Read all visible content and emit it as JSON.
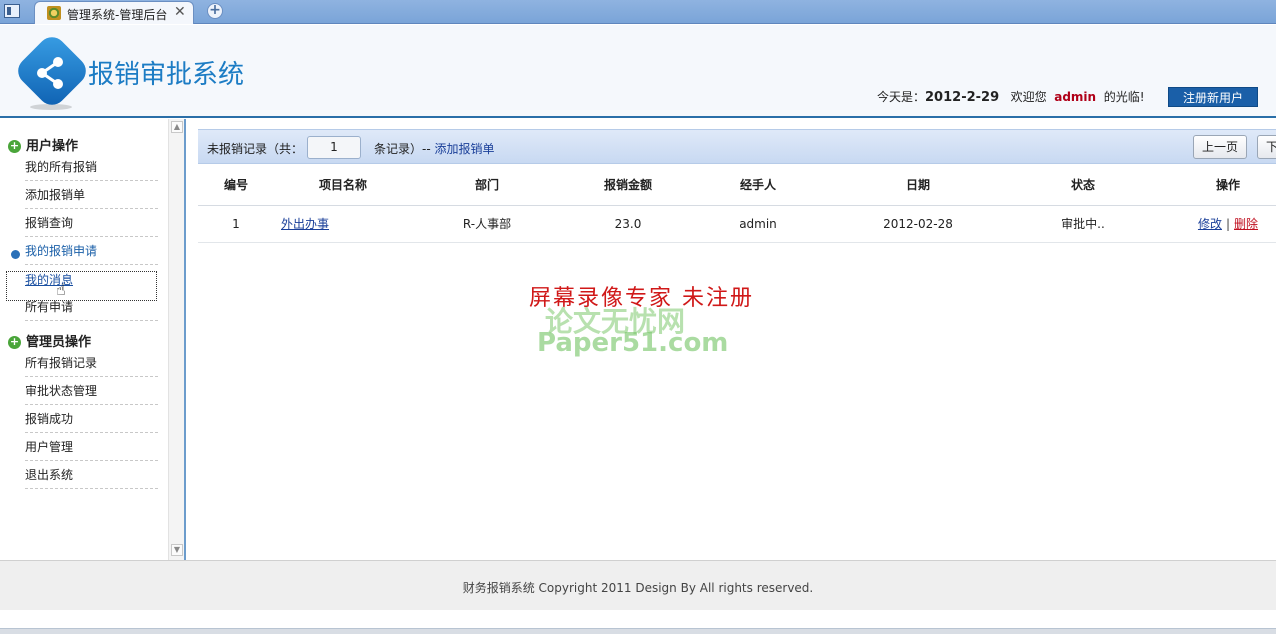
{
  "browser": {
    "tab_title": "管理系统-管理后台",
    "tab_close": "✕",
    "new_tab": "+"
  },
  "header": {
    "system_title": "报销审批系统",
    "today_label": "今天是：",
    "today_date": "2012-2-29",
    "welcome_prefix": "欢迎您",
    "welcome_user": "admin",
    "welcome_suffix": "的光临!",
    "register_button": "注册新用户"
  },
  "sidebar": {
    "user_section": "用户操作",
    "user_items": [
      "我的所有报销",
      "添加报销单",
      "报销查询",
      "我的报销申请",
      "我的消息",
      "所有申请"
    ],
    "admin_section": "管理员操作",
    "admin_items": [
      "所有报销记录",
      "审批状态管理",
      "报销成功",
      "用户管理",
      "退出系统"
    ]
  },
  "toolbar": {
    "label": "未报销记录（共：",
    "count": "1",
    "suffix": "条记录）--",
    "add_link": "添加报销单",
    "prev_button": "上一页",
    "next_button": "下"
  },
  "table": {
    "headers": [
      "编号",
      "项目名称",
      "部门",
      "报销金额",
      "经手人",
      "日期",
      "状态",
      "操作"
    ],
    "rows": [
      {
        "id": "1",
        "name": "外出办事",
        "dept": "R-人事部",
        "amount": "23.0",
        "handler": "admin",
        "date": "2012-02-28",
        "status": "审批中..",
        "edit": "修改",
        "sep": "|",
        "delete": "删除"
      }
    ]
  },
  "watermark": {
    "line1": "屏幕录像专家   未注册",
    "line2": "论文无忧网",
    "line3": "Paper51.com"
  },
  "footer": {
    "text": "财务报销系统  Copyright 2011 Design By All rights reserved."
  },
  "colors": {
    "accent": "#1c7cc4",
    "header_border": "#2a6fa8",
    "register_bg": "#1a5fa8",
    "delete_red": "#c01020"
  }
}
